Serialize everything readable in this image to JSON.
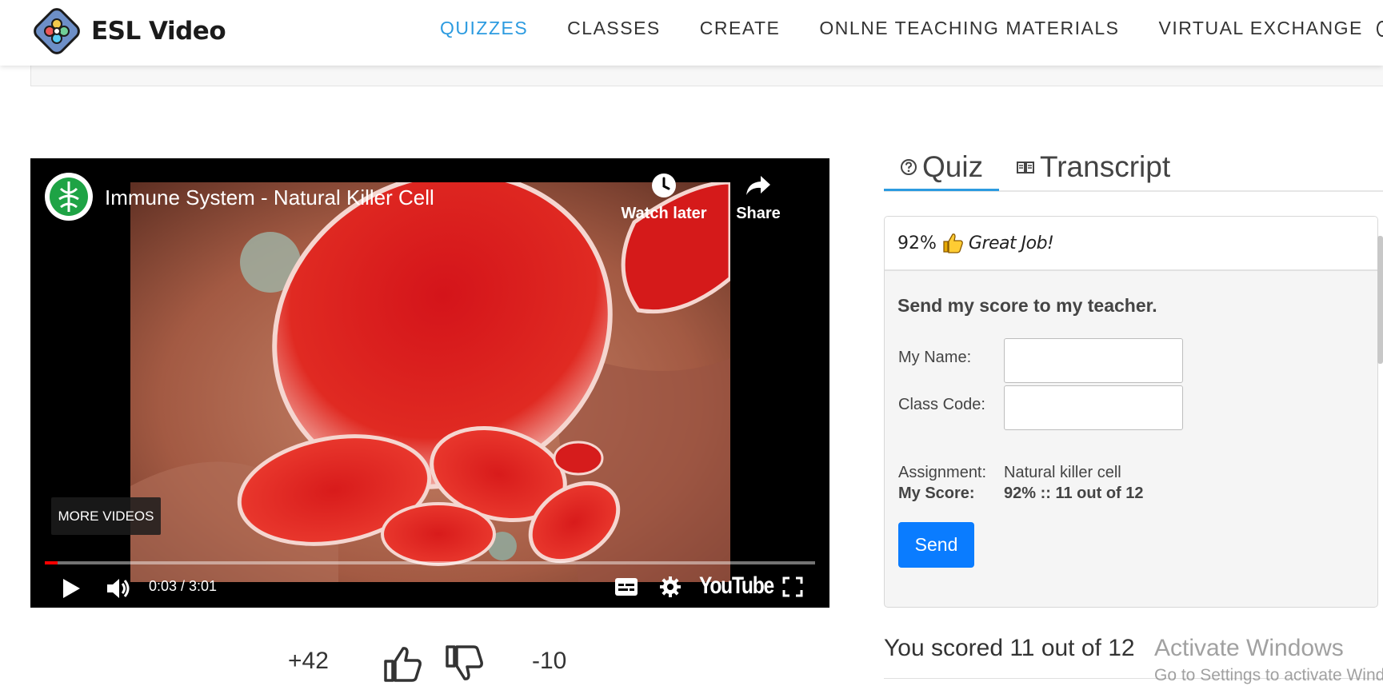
{
  "header": {
    "brand": "ESL Video",
    "nav": [
      {
        "label": "QUIZZES",
        "active": true
      },
      {
        "label": "CLASSES",
        "active": false
      },
      {
        "label": "CREATE",
        "active": false
      },
      {
        "label": "ONLNE TEACHING MATERIALS",
        "active": false
      },
      {
        "label": "VIRTUAL EXCHANGE",
        "active": false
      }
    ],
    "accent_color": "#2c9be0"
  },
  "video": {
    "title": "Immune System - Natural Killer Cell",
    "watch_later_label": "Watch later",
    "share_label": "Share",
    "more_videos_label": "MORE VIDEOS",
    "timecode": "0:03 / 3:01",
    "progress_fraction": 0.017,
    "brand_logo": "YouTube",
    "icons": [
      "play-icon",
      "volume-icon",
      "subtitles-icon",
      "settings-icon",
      "fullscreen-icon",
      "clock-icon",
      "share-icon"
    ]
  },
  "votes": {
    "up_count": "+42",
    "down_count": "-10"
  },
  "tabs": {
    "quiz_label": "Quiz",
    "transcript_label": "Transcript",
    "active": "quiz"
  },
  "score_card": {
    "percent": "92%",
    "praise": "Great Job!",
    "send_title": "Send my score to my teacher.",
    "name_label": "My Name:",
    "name_value": "",
    "class_code_label": "Class Code:",
    "class_code_value": "",
    "assignment_label": "Assignment:",
    "assignment_value": "Natural killer cell",
    "my_score_label": "My Score:",
    "my_score_value": "92% :: 11 out of 12",
    "send_label": "Send",
    "button_color": "#0a7cff"
  },
  "summary": {
    "scored_text": "You scored 11 out of 12"
  },
  "watermark": {
    "line1": "Activate Windows",
    "line2": "Go to Settings to activate Windows."
  }
}
